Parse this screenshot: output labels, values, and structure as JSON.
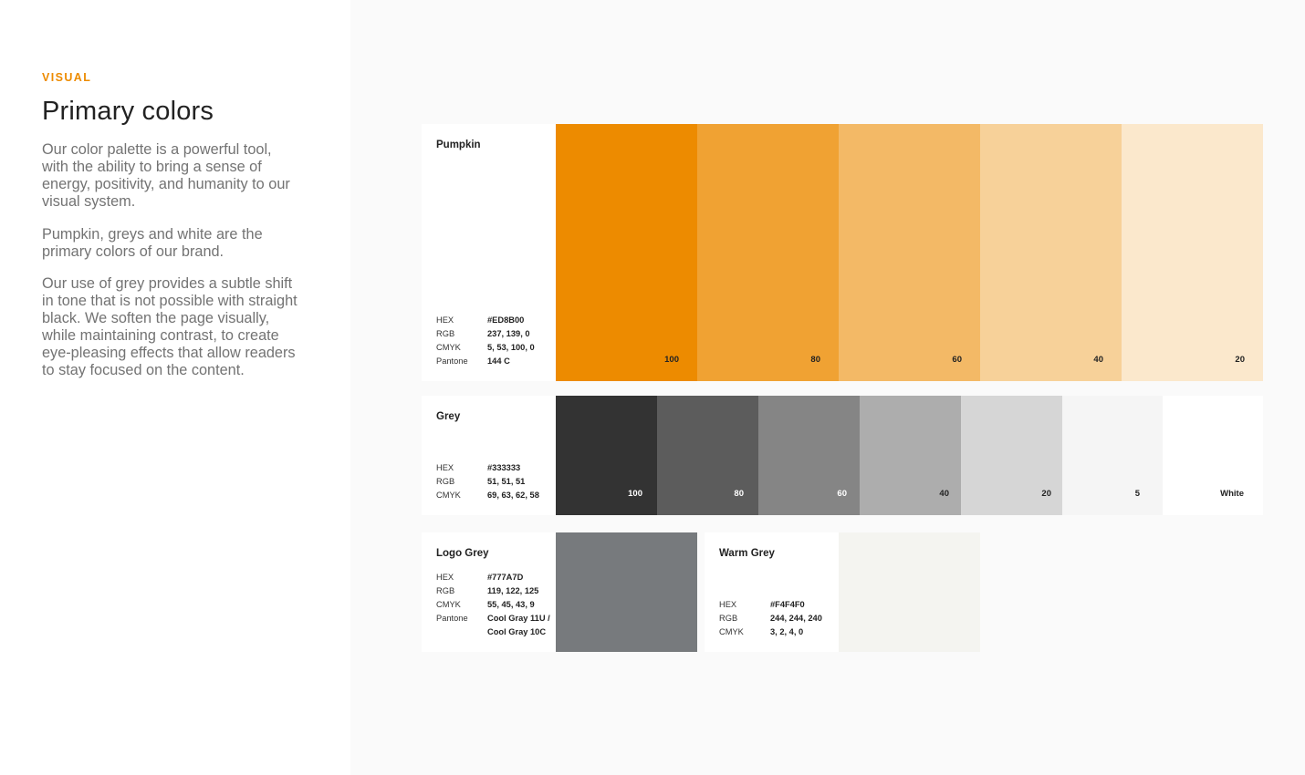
{
  "intro": {
    "eyebrow": "VISUAL",
    "title": "Primary colors",
    "paragraphs": [
      "Our color palette is a powerful tool, with the ability to bring a sense of energy, positivity, and humanity to our visual system.",
      "Pumpkin, greys and white are the primary colors of our brand.",
      "Our use of grey provides a subtle shift in tone that is not possible with straight black. We soften the page visually, while maintaining contrast, to create eye-pleasing effects that allow readers to stay focused on the content."
    ]
  },
  "colors": {
    "accent": "#ED8B00"
  },
  "pumpkin": {
    "name": "Pumpkin",
    "specs": [
      {
        "key": "HEX",
        "value": "#ED8B00"
      },
      {
        "key": "RGB",
        "value": "237, 139, 0"
      },
      {
        "key": "CMYK",
        "value": "5, 53, 100, 0"
      },
      {
        "key": "Pantone",
        "value": "144 C"
      }
    ],
    "swatches": [
      {
        "label": "100",
        "color": "#ED8B00"
      },
      {
        "label": "80",
        "color": "#F0A233"
      },
      {
        "label": "60",
        "color": "#F3B966"
      },
      {
        "label": "40",
        "color": "#F7D199"
      },
      {
        "label": "20",
        "color": "#FBE8CC"
      }
    ]
  },
  "grey": {
    "name": "Grey",
    "specs": [
      {
        "key": "HEX",
        "value": "#333333"
      },
      {
        "key": "RGB",
        "value": "51, 51, 51"
      },
      {
        "key": "CMYK",
        "value": "69, 63, 62, 58"
      }
    ],
    "swatches": [
      {
        "label": "100",
        "color": "#333333"
      },
      {
        "label": "80",
        "color": "#5C5C5C"
      },
      {
        "label": "60",
        "color": "#858585"
      },
      {
        "label": "40",
        "color": "#ADADAD"
      },
      {
        "label": "20",
        "color": "#D6D6D6"
      },
      {
        "label": "5",
        "color": "#F5F5F5"
      },
      {
        "label": "White",
        "color": "#FFFFFF"
      }
    ]
  },
  "logo_grey": {
    "name": "Logo Grey",
    "specs": [
      {
        "key": "HEX",
        "value": "#777A7D"
      },
      {
        "key": "RGB",
        "value": "119, 122, 125"
      },
      {
        "key": "CMYK",
        "value": "55, 45, 43, 9"
      },
      {
        "key": "Pantone",
        "value": "Cool Gray 11U /"
      },
      {
        "key": "",
        "value": "Cool Gray 10C"
      }
    ],
    "swatch_color": "#777A7D"
  },
  "warm_grey": {
    "name": "Warm Grey",
    "specs": [
      {
        "key": "HEX",
        "value": "#F4F4F0"
      },
      {
        "key": "RGB",
        "value": "244, 244, 240"
      },
      {
        "key": "CMYK",
        "value": "3, 2, 4, 0"
      }
    ],
    "swatch_color": "#F4F4F0"
  }
}
